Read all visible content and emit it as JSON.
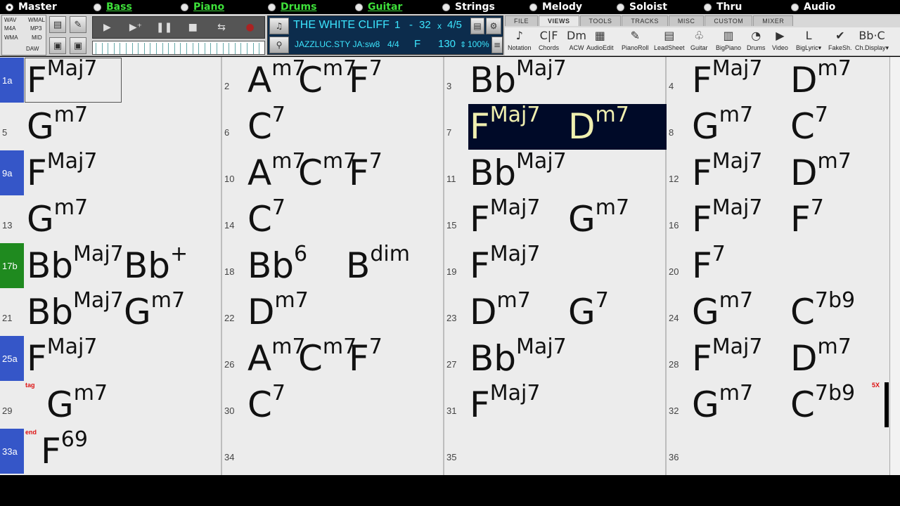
{
  "tracks": [
    {
      "label": "Master",
      "green": false,
      "sel": true
    },
    {
      "label": "Bass",
      "green": true,
      "sel": false
    },
    {
      "label": "Piano",
      "green": true,
      "sel": false
    },
    {
      "label": "Drums",
      "green": true,
      "sel": false
    },
    {
      "label": "Guitar",
      "green": true,
      "sel": false
    },
    {
      "label": "Strings",
      "green": false,
      "sel": false
    },
    {
      "label": "Melody",
      "green": false,
      "sel": false
    },
    {
      "label": "Soloist",
      "green": false,
      "sel": false
    },
    {
      "label": "Thru",
      "green": false,
      "sel": false
    },
    {
      "label": "Audio",
      "green": false,
      "sel": false
    }
  ],
  "media": {
    "wav": "WAV",
    "wma1": "WMAL",
    "m4a": "M4A",
    "mp3": "MP3",
    "wma": "WMA",
    "mid": "MID",
    "daw": "DAW"
  },
  "song": {
    "title": "THE WHITE CLIFF",
    "bar_start": "1",
    "dash": "-",
    "bar_end": "32",
    "times": "x",
    "repeats": "4/5",
    "style": "JAZZLUC.STY JA:",
    "feel": "sw8",
    "time_sig": "4/4",
    "key": "F",
    "tempo": "130",
    "volume": "100%"
  },
  "menu_tabs": [
    "FILE",
    "VIEWS",
    "TOOLS",
    "TRACKS",
    "MISC",
    "CUSTOM",
    "MIXER"
  ],
  "view_buttons": [
    {
      "label": "Notation",
      "icon": "♪"
    },
    {
      "label": "Chords",
      "icon": "C|F"
    },
    {
      "label": "ACW",
      "icon": "Dm"
    },
    {
      "label": "AudioEdit",
      "icon": "▦"
    },
    {
      "label": "PianoRoll",
      "icon": "✎"
    },
    {
      "label": "LeadSheet",
      "icon": "▤"
    },
    {
      "label": "Guitar",
      "icon": "♧"
    },
    {
      "label": "BigPiano",
      "icon": "▥"
    },
    {
      "label": "Drums",
      "icon": "◔"
    },
    {
      "label": "Video",
      "icon": "▶"
    },
    {
      "label": "BigLyric▾",
      "icon": "L"
    },
    {
      "label": "FakeSh.",
      "icon": "✔"
    },
    {
      "label": "Ch.Display▾",
      "icon": "Bb·C"
    }
  ],
  "sections": [
    {
      "label": "1a",
      "row": 0,
      "green": false
    },
    {
      "label": "9a",
      "row": 2,
      "green": false
    },
    {
      "label": "17b",
      "row": 4,
      "green": true
    },
    {
      "label": "25a",
      "row": 6,
      "green": false
    },
    {
      "label": "33a",
      "row": 8,
      "green": false
    }
  ],
  "bars": [
    {
      "n": "",
      "col": 0,
      "row": 0,
      "chords": [
        {
          "r": "F",
          "e": "Maj7"
        }
      ]
    },
    {
      "n": "2",
      "col": 1,
      "row": 0,
      "chords": [
        {
          "r": "A",
          "e": "m7"
        },
        {
          "r": "C",
          "e": "m7"
        },
        {
          "r": "F",
          "e": "7"
        }
      ]
    },
    {
      "n": "3",
      "col": 2,
      "row": 0,
      "chords": [
        {
          "r": "Bb",
          "e": "Maj7"
        }
      ]
    },
    {
      "n": "4",
      "col": 3,
      "row": 0,
      "chords": [
        {
          "r": "F",
          "e": "Maj7"
        },
        {
          "r": "D",
          "e": "m7"
        }
      ]
    },
    {
      "n": "5",
      "col": 0,
      "row": 1,
      "chords": [
        {
          "r": "G",
          "e": "m7"
        }
      ]
    },
    {
      "n": "6",
      "col": 1,
      "row": 1,
      "chords": [
        {
          "r": "C",
          "e": "7"
        }
      ]
    },
    {
      "n": "7",
      "col": 2,
      "row": 1,
      "chords": [
        {
          "r": "F",
          "e": "Maj7"
        },
        {
          "r": "D",
          "e": "m7"
        }
      ],
      "hl": true
    },
    {
      "n": "8",
      "col": 3,
      "row": 1,
      "chords": [
        {
          "r": "G",
          "e": "m7"
        },
        {
          "r": "C",
          "e": "7"
        }
      ]
    },
    {
      "n": "",
      "col": 0,
      "row": 2,
      "chords": [
        {
          "r": "F",
          "e": "Maj7"
        }
      ]
    },
    {
      "n": "10",
      "col": 1,
      "row": 2,
      "chords": [
        {
          "r": "A",
          "e": "m7"
        },
        {
          "r": "C",
          "e": "m7"
        },
        {
          "r": "F",
          "e": "7"
        }
      ]
    },
    {
      "n": "11",
      "col": 2,
      "row": 2,
      "chords": [
        {
          "r": "Bb",
          "e": "Maj7"
        }
      ]
    },
    {
      "n": "12",
      "col": 3,
      "row": 2,
      "chords": [
        {
          "r": "F",
          "e": "Maj7"
        },
        {
          "r": "D",
          "e": "m7"
        }
      ]
    },
    {
      "n": "13",
      "col": 0,
      "row": 3,
      "chords": [
        {
          "r": "G",
          "e": "m7"
        }
      ]
    },
    {
      "n": "14",
      "col": 1,
      "row": 3,
      "chords": [
        {
          "r": "C",
          "e": "7"
        }
      ]
    },
    {
      "n": "15",
      "col": 2,
      "row": 3,
      "chords": [
        {
          "r": "F",
          "e": "Maj7"
        },
        {
          "r": "G",
          "e": "m7"
        }
      ]
    },
    {
      "n": "16",
      "col": 3,
      "row": 3,
      "chords": [
        {
          "r": "F",
          "e": "Maj7"
        },
        {
          "r": "F",
          "e": "7"
        }
      ]
    },
    {
      "n": "",
      "col": 0,
      "row": 4,
      "chords": [
        {
          "r": "Bb",
          "e": "Maj7"
        },
        {
          "r": "Bb",
          "e": "+"
        }
      ]
    },
    {
      "n": "18",
      "col": 1,
      "row": 4,
      "chords": [
        {
          "r": "Bb",
          "e": "6"
        },
        {
          "r": "B",
          "e": "dim"
        }
      ]
    },
    {
      "n": "19",
      "col": 2,
      "row": 4,
      "chords": [
        {
          "r": "F",
          "e": "Maj7"
        }
      ]
    },
    {
      "n": "20",
      "col": 3,
      "row": 4,
      "chords": [
        {
          "r": "F",
          "e": "7"
        }
      ]
    },
    {
      "n": "21",
      "col": 0,
      "row": 5,
      "chords": [
        {
          "r": "Bb",
          "e": "Maj7"
        },
        {
          "r": "G",
          "e": "m7"
        }
      ]
    },
    {
      "n": "22",
      "col": 1,
      "row": 5,
      "chords": [
        {
          "r": "D",
          "e": "m7"
        }
      ]
    },
    {
      "n": "23",
      "col": 2,
      "row": 5,
      "chords": [
        {
          "r": "D",
          "e": "m7"
        },
        {
          "r": "G",
          "e": "7"
        }
      ]
    },
    {
      "n": "24",
      "col": 3,
      "row": 5,
      "chords": [
        {
          "r": "G",
          "e": "m7"
        },
        {
          "r": "C",
          "e": "7b9"
        }
      ]
    },
    {
      "n": "",
      "col": 0,
      "row": 6,
      "chords": [
        {
          "r": "F",
          "e": "Maj7"
        }
      ]
    },
    {
      "n": "26",
      "col": 1,
      "row": 6,
      "chords": [
        {
          "r": "A",
          "e": "m7"
        },
        {
          "r": "C",
          "e": "m7"
        },
        {
          "r": "F",
          "e": "7"
        }
      ]
    },
    {
      "n": "27",
      "col": 2,
      "row": 6,
      "chords": [
        {
          "r": "Bb",
          "e": "Maj7"
        }
      ]
    },
    {
      "n": "28",
      "col": 3,
      "row": 6,
      "chords": [
        {
          "r": "F",
          "e": "Maj7"
        },
        {
          "r": "D",
          "e": "m7"
        }
      ]
    },
    {
      "n": "29",
      "col": 0,
      "row": 7,
      "chords": [
        {
          "r": "G",
          "e": "m7"
        }
      ],
      "indent": true
    },
    {
      "n": "30",
      "col": 1,
      "row": 7,
      "chords": [
        {
          "r": "C",
          "e": "7"
        }
      ]
    },
    {
      "n": "31",
      "col": 2,
      "row": 7,
      "chords": [
        {
          "r": "F",
          "e": "Maj7"
        }
      ]
    },
    {
      "n": "32",
      "col": 3,
      "row": 7,
      "chords": [
        {
          "r": "G",
          "e": "m7"
        },
        {
          "r": "C",
          "e": "7b9"
        }
      ]
    },
    {
      "n": "",
      "col": 0,
      "row": 8,
      "chords": [
        {
          "r": "F",
          "e": "69"
        }
      ],
      "indent": true
    },
    {
      "n": "34",
      "col": 1,
      "row": 8,
      "chords": []
    },
    {
      "n": "35",
      "col": 2,
      "row": 8,
      "chords": []
    },
    {
      "n": "36",
      "col": 3,
      "row": 8,
      "chords": []
    }
  ],
  "markers": {
    "tag": "tag",
    "end": "end",
    "repeat": "5X"
  }
}
